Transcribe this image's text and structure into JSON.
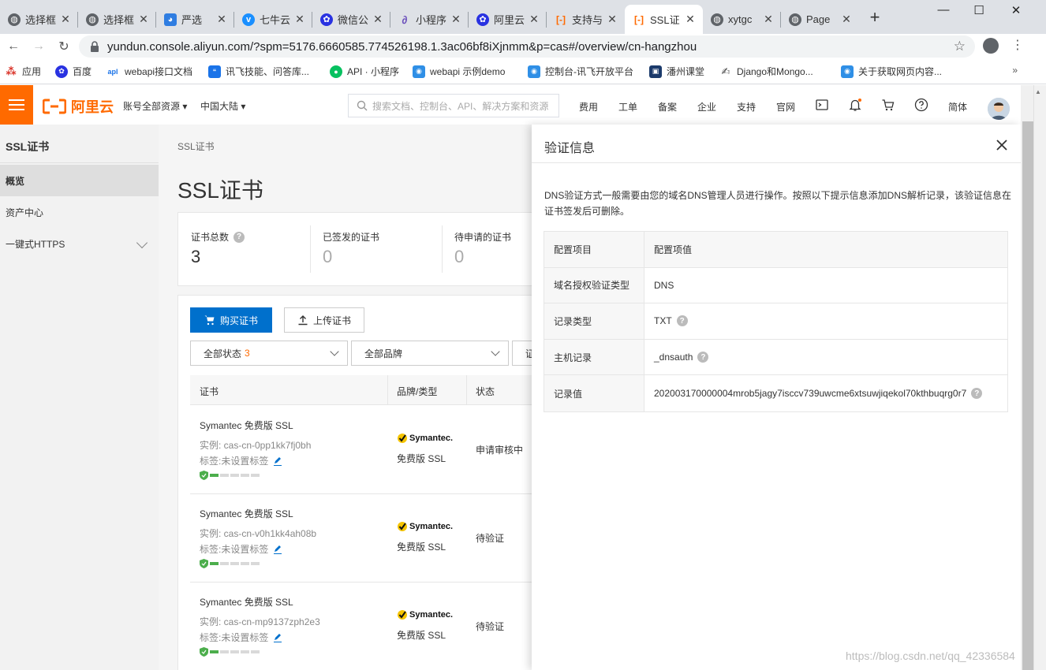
{
  "browser": {
    "tabs": [
      {
        "title": "选择框",
        "favicon": "globe-icon"
      },
      {
        "title": "选择框",
        "favicon": "globe-icon"
      },
      {
        "title": "严选",
        "favicon": "app-icon"
      },
      {
        "title": "七牛云",
        "favicon": "qiniu-icon"
      },
      {
        "title": "微信公",
        "favicon": "baidu-paw-icon"
      },
      {
        "title": "小程序",
        "favicon": "link-icon"
      },
      {
        "title": "阿里云",
        "favicon": "baidu-paw-icon"
      },
      {
        "title": "支持与",
        "favicon": "aliyun-icon"
      },
      {
        "title": "SSL证",
        "favicon": "aliyun-icon"
      },
      {
        "title": "xytgc",
        "favicon": "globe-icon"
      },
      {
        "title": "Page",
        "favicon": "globe-icon"
      }
    ],
    "url": "yundun.console.aliyun.com/?spm=5176.6660585.774526198.1.3ac06bf8iXjnmm&p=cas#/overview/cn-hangzhou",
    "bookmarks": [
      "应用",
      "百度",
      "webapi接口文档",
      "讯飞技能、问答库...",
      "API · 小程序",
      "webapi 示例demo",
      "控制台-讯飞开放平台",
      "潘州课堂",
      "Django和Mongo...",
      "关于获取网页内容..."
    ],
    "bookmarks_more": "»"
  },
  "header": {
    "logo_text": "阿里云",
    "account_dropdown": "账号全部资源",
    "region_dropdown": "中国大陆",
    "search_placeholder": "搜索文档、控制台、API、解决方案和资源",
    "links": [
      "费用",
      "工单",
      "备案",
      "企业",
      "支持",
      "官网"
    ],
    "language": "简体"
  },
  "sidebar": {
    "title": "SSL证书",
    "items": [
      {
        "label": "概览",
        "active": true
      },
      {
        "label": "资产中心",
        "active": false
      },
      {
        "label": "一键式HTTPS",
        "active": false
      }
    ]
  },
  "main": {
    "breadcrumb": "SSL证书",
    "title": "SSL证书",
    "stats": [
      {
        "label": "证书总数",
        "value": "3"
      },
      {
        "label": "已签发的证书",
        "value": "0"
      },
      {
        "label": "待申请的证书",
        "value": "0"
      }
    ],
    "buy_button": "购买证书",
    "upload_button": "上传证书",
    "filter_status": "全部状态",
    "filter_status_count": "3",
    "filter_brand": "全部品牌",
    "filter_third": "证",
    "columns": [
      "证书",
      "品牌/类型",
      "状态"
    ],
    "rows": [
      {
        "name": "Symantec 免费版 SSL",
        "instance": "实例: cas-cn-0pp1kk7fj0bh",
        "tag": "标签:未设置标签",
        "brand": "Symantec.",
        "type": "免费版 SSL",
        "status": "申请审核中",
        "progress": 0.2
      },
      {
        "name": "Symantec 免费版 SSL",
        "instance": "实例: cas-cn-v0h1kk4ah08b",
        "tag": "标签:未设置标签",
        "brand": "Symantec.",
        "type": "免费版 SSL",
        "status": "待验证",
        "progress": 0.2
      },
      {
        "name": "Symantec 免费版 SSL",
        "instance": "实例: cas-cn-mp9137zph2e3",
        "tag": "标签:未设置标签",
        "brand": "Symantec.",
        "type": "免费版 SSL",
        "status": "待验证",
        "progress": 0.2
      }
    ]
  },
  "drawer": {
    "title": "验证信息",
    "description": "DNS验证方式一般需要由您的域名DNS管理人员进行操作。按照以下提示信息添加DNS解析记录，该验证信息在证书签发后可删除。",
    "header_key": "配置项目",
    "header_value": "配置项值",
    "items": [
      {
        "key": "域名授权验证类型",
        "value": "DNS",
        "help": false
      },
      {
        "key": "记录类型",
        "value": "TXT",
        "help": true
      },
      {
        "key": "主机记录",
        "value": "_dnsauth",
        "help": true
      },
      {
        "key": "记录值",
        "value": "202003170000004mrob5jagy7isccv739uwcme6xtsuwjiqekol70kthbuqrg0r7",
        "help": true
      }
    ]
  },
  "page_edge": "00",
  "watermark": "https://blog.csdn.net/qq_42336584",
  "colors": {
    "accent": "#ff6a00",
    "primary": "#0070cc",
    "success": "#4cae4c"
  }
}
